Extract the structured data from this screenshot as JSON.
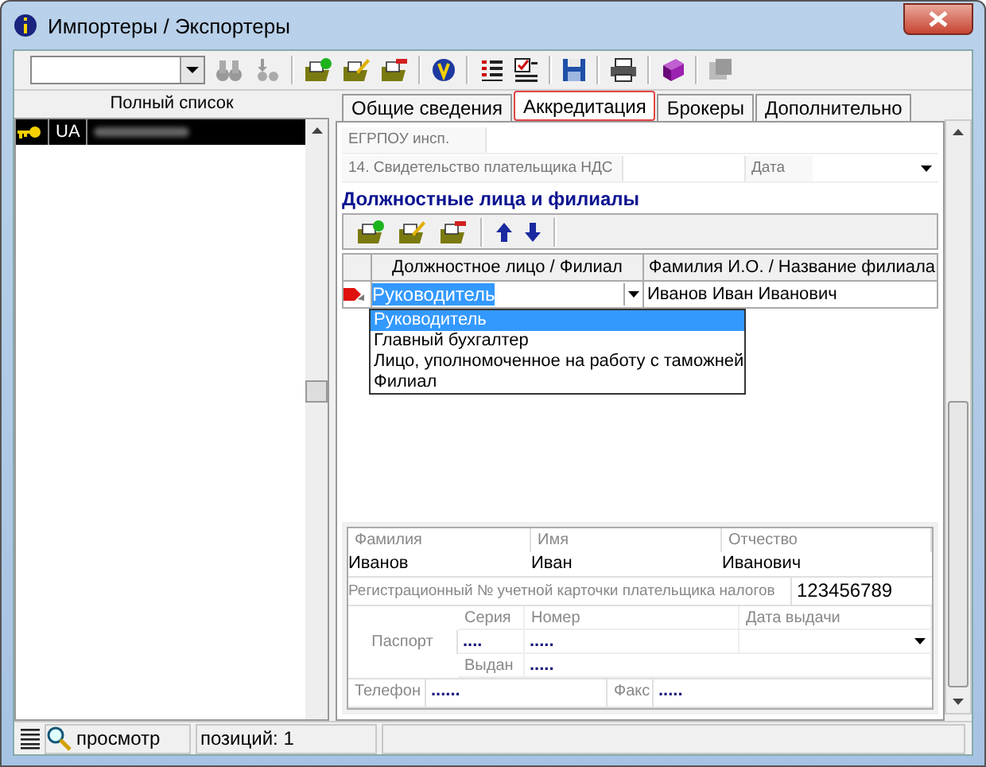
{
  "window": {
    "title": "Импортеры / Экспортеры"
  },
  "list": {
    "header": "Полный список",
    "rows": [
      {
        "code": "UA",
        "selected": true
      }
    ]
  },
  "tabs": [
    {
      "label": "Общие сведения",
      "selected": false
    },
    {
      "label": "Аккредитация",
      "selected": true
    },
    {
      "label": "Брокеры",
      "selected": false
    },
    {
      "label": "Дополнительно",
      "selected": false
    }
  ],
  "form": {
    "edrpou_label": "ЕГРПОУ инсп.",
    "vat_label": "14. Свидетельство плательщика НДС",
    "date_label": "Дата"
  },
  "section_title": "Должностные лица  и филиалы",
  "grid": {
    "columns": [
      "Должностное лицо / Филиал",
      "Фамилия И.О. / Название филиала"
    ],
    "rows": [
      {
        "position": "Руководитель",
        "name": "Иванов Иван Иванович",
        "current": true
      }
    ],
    "options": [
      {
        "label": "Руководитель",
        "selected": true
      },
      {
        "label": "Главный бухгалтер",
        "selected": false
      },
      {
        "label": "Лицо, уполномоченное на работу с таможней",
        "selected": false
      },
      {
        "label": "Филиал",
        "selected": false
      }
    ]
  },
  "details": {
    "surname_label": "Фамилия",
    "name_label": "Имя",
    "patronymic_label": "Отчество",
    "surname": "Иванов",
    "name": "Иван",
    "patronymic": "Иванович",
    "tax_label": "Регистрационный № учетной карточки плательщика налогов",
    "tax": "123456789",
    "passport_label": "Паспорт",
    "series_label": "Серия",
    "number_label": "Номер",
    "issue_date_label": "Дата выдачи",
    "series": "....",
    "number": ".....",
    "issued_label": "Выдан",
    "issued": ".....",
    "phone_label": "Телефон",
    "phone": "......",
    "fax_label": "Факс",
    "fax": "....."
  },
  "status_bar": {
    "mode": "просмотр",
    "count": "позиций: 1"
  }
}
